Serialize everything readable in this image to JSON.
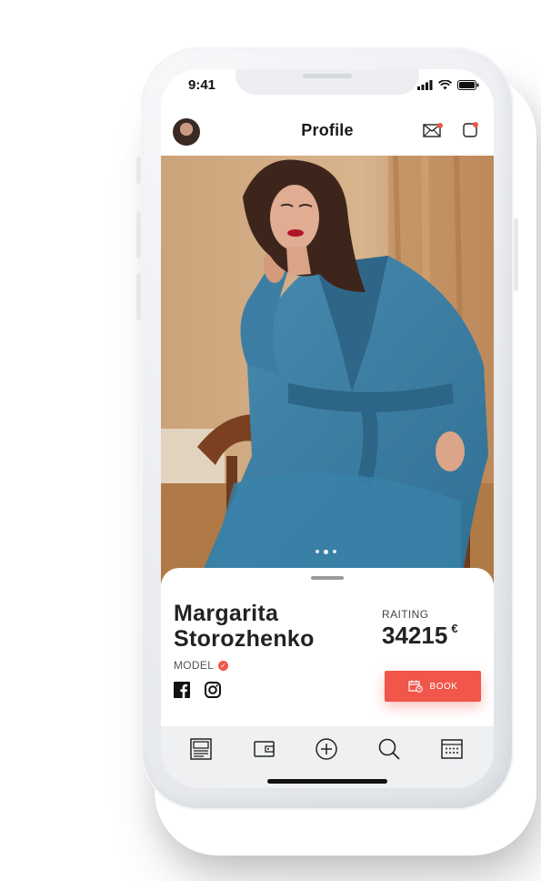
{
  "status_bar": {
    "time": "9:41"
  },
  "header": {
    "title": "Profile",
    "avatar_icon": "avatar",
    "mail_icon": "mail-icon",
    "notification_icon": "notification-icon"
  },
  "gallery": {
    "pages": 3,
    "active_page": 2
  },
  "profile": {
    "first_name": "Margarita",
    "last_name": "Storozhenko",
    "role": "MODEL",
    "verified": true,
    "social": [
      "facebook-icon",
      "instagram-icon"
    ],
    "rating_label": "RAITING",
    "rating_value": "34215",
    "rating_currency": "€",
    "book_label": "BOOK"
  },
  "tabbar": {
    "items": [
      "portfolio-icon",
      "wallet-icon",
      "add-icon",
      "search-icon",
      "calendar-icon"
    ]
  },
  "colors": {
    "accent": "#f0564a",
    "coat": "#3d7fa3",
    "tabbar": "#eef0f2"
  }
}
